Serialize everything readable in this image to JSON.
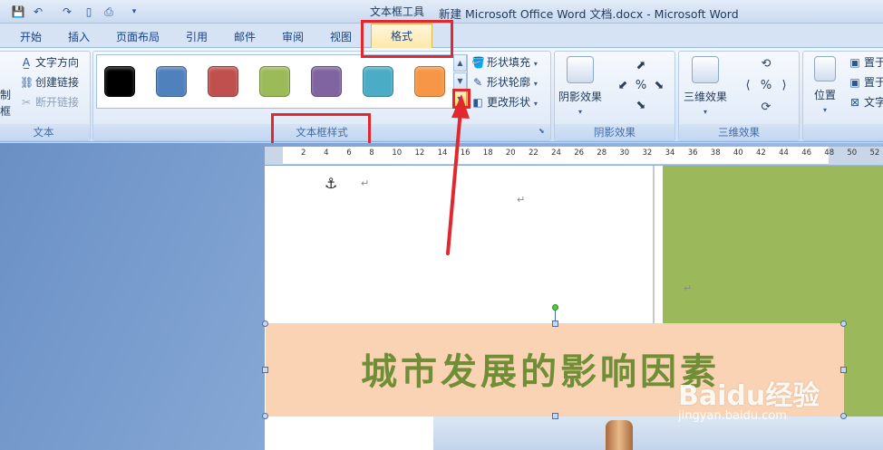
{
  "window": {
    "title": "新建 Microsoft Office Word 文档.docx - Microsoft Word",
    "context_tool": "文本框工具"
  },
  "tabs": [
    "开始",
    "插入",
    "页面布局",
    "引用",
    "邮件",
    "审阅",
    "视图"
  ],
  "active_tab": "格式",
  "groups": {
    "text": {
      "label": "文本",
      "items": [
        "文字方向",
        "创建链接",
        "断开链接"
      ],
      "left_labels": [
        "制",
        "框"
      ]
    },
    "textbox_styles": {
      "label": "文本框样式",
      "swatches": [
        "#000000",
        "#4f81bd",
        "#c0504d",
        "#9bbb59",
        "#8064a2",
        "#4bacc6",
        "#f79646"
      ],
      "fill": "形状填充",
      "outline": "形状轮廓",
      "change_shape": "更改形状"
    },
    "shadow": {
      "label": "阴影效果",
      "button": "阴影效果"
    },
    "threed": {
      "label": "三维效果",
      "button": "三维效果"
    },
    "arrange": {
      "position": "位置",
      "front": "置于",
      "back": "置于",
      "wrap": "文字"
    }
  },
  "ruler_ticks": [
    "2",
    "4",
    "6",
    "8",
    "10",
    "12",
    "14",
    "16",
    "18",
    "20",
    "22",
    "24",
    "26",
    "28",
    "30",
    "32",
    "34",
    "36",
    "38",
    "40",
    "42",
    "44",
    "46",
    "48",
    "50",
    "52"
  ],
  "document": {
    "textbox_text": "城市发展的影响因素"
  },
  "watermark": {
    "brand": "Baidu经验",
    "url": "jingyan.baidu.com"
  },
  "colors": {
    "highlight": "#e0282e",
    "textbox_fill": "#fad3b4",
    "textbox_text": "#6f8e36",
    "green_block": "#9bb85a"
  }
}
